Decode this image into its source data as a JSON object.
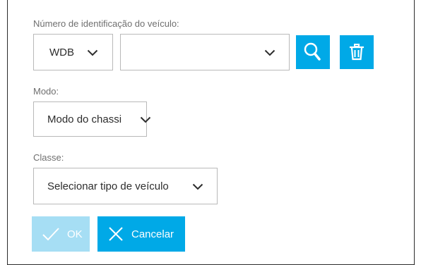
{
  "vin": {
    "label": "Número de identificação do veículo:",
    "prefix_value": "WDB",
    "number_value": ""
  },
  "mode": {
    "label": "Modo:",
    "value": "Modo do chassi"
  },
  "class": {
    "label": "Classe:",
    "value": "Selecionar tipo de veículo"
  },
  "buttons": {
    "ok_label": "OK",
    "cancel_label": "Cancelar"
  },
  "colors": {
    "accent": "#00a9e7",
    "accent_disabled": "#a6def4",
    "border": "#b9b9b9",
    "label_text": "#6f6f6f"
  },
  "icons": {
    "search": "search-icon",
    "delete": "trash-icon",
    "ok": "check-icon",
    "cancel": "close-icon",
    "dropdown": "chevron-down-icon"
  }
}
